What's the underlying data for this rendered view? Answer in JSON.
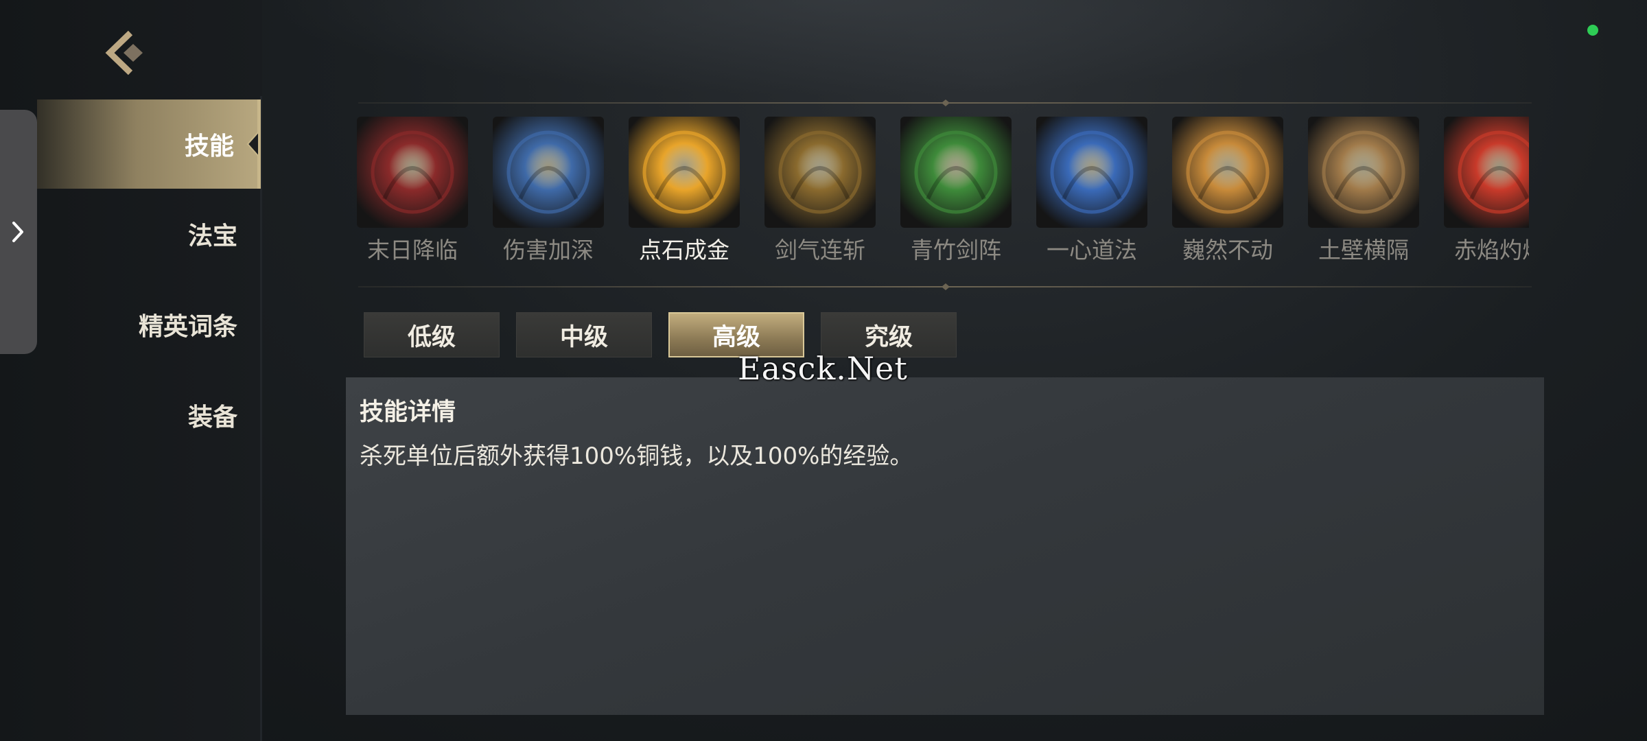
{
  "sidebar": {
    "items": [
      {
        "label": "技能",
        "active": true
      },
      {
        "label": "法宝",
        "active": false
      },
      {
        "label": "精英词条",
        "active": false
      },
      {
        "label": "装备",
        "active": false
      }
    ]
  },
  "skills": [
    {
      "name": "末日降临",
      "icon": "doom-orb-icon",
      "color": "#8a2a2a"
    },
    {
      "name": "伤害加深",
      "icon": "meditating-figure-icon",
      "color": "#3f6aa8"
    },
    {
      "name": "点石成金",
      "icon": "golden-vortex-icon",
      "color": "#e8a42a",
      "selected": true
    },
    {
      "name": "剑气连斩",
      "icon": "sword-slash-icon",
      "color": "#8a6a2e"
    },
    {
      "name": "青竹剑阵",
      "icon": "bamboo-sword-icon",
      "color": "#3e8a3a"
    },
    {
      "name": "一心道法",
      "icon": "crystal-shield-icon",
      "color": "#3a6ab8"
    },
    {
      "name": "巍然不动",
      "icon": "golden-seal-icon",
      "color": "#c78a3a"
    },
    {
      "name": "土壁横隔",
      "icon": "earth-wall-icon",
      "color": "#a07a4a"
    },
    {
      "name": "赤焰灼烧",
      "icon": "flame-dragon-icon",
      "color": "#c83a2a"
    }
  ],
  "tiers": [
    {
      "label": "低级",
      "active": false
    },
    {
      "label": "中级",
      "active": false
    },
    {
      "label": "高级",
      "active": true
    },
    {
      "label": "究级",
      "active": false
    }
  ],
  "details": {
    "title": "技能详情",
    "description": "杀死单位后额外获得100%铜钱，以及100%的经验。"
  },
  "watermark": "Easck.Net",
  "colors": {
    "accent_gold": "#c7b68a",
    "status_online": "#2ecc55"
  }
}
